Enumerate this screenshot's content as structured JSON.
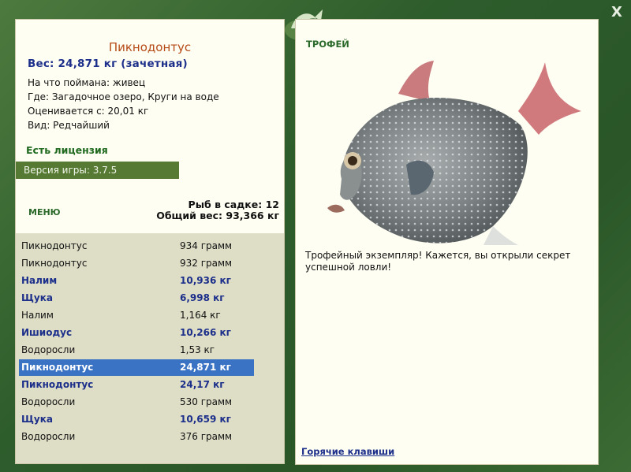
{
  "window": {
    "close_label": "X"
  },
  "fish": {
    "title": "Пикнодонтус",
    "weight": "Вес: 24,871 кг (зачетная)",
    "bait": "На что поймана: живец",
    "location": "Где: Загадочное озеро, Круги на воде",
    "value": "Оценивается с: 20,01 кг",
    "rarity": "Вид: Редчайший"
  },
  "license": "Есть лицензия",
  "version": "Версия игры: 3.7.5",
  "menu_label": "МЕНЮ",
  "stats": {
    "count": "Рыб в садке: 12",
    "total_weight": "Общий вес: 93,366 кг"
  },
  "catch_list": [
    {
      "name": "Пикнодонтус",
      "weight": "934 грамм",
      "style": "normal"
    },
    {
      "name": "Пикнодонтус",
      "weight": "932 грамм",
      "style": "normal"
    },
    {
      "name": "Налим",
      "weight": "10,936 кг",
      "style": "bold"
    },
    {
      "name": "Щука",
      "weight": "6,998 кг",
      "style": "bold"
    },
    {
      "name": "Налим",
      "weight": "1,164 кг",
      "style": "normal"
    },
    {
      "name": "Ишиодус",
      "weight": "10,266 кг",
      "style": "bold"
    },
    {
      "name": "Водоросли",
      "weight": "1,53 кг",
      "style": "normal"
    },
    {
      "name": "Пикнодонтус",
      "weight": "24,871 кг",
      "style": "selected"
    },
    {
      "name": "Пикнодонтус",
      "weight": "24,17 кг",
      "style": "bold"
    },
    {
      "name": "Водоросли",
      "weight": "530 грамм",
      "style": "normal"
    },
    {
      "name": "Щука",
      "weight": "10,659 кг",
      "style": "bold"
    },
    {
      "name": "Водоросли",
      "weight": "376 грамм",
      "style": "normal"
    }
  ],
  "trophy": {
    "label": "ТРОФЕЙ",
    "text": "Трофейный экземпляр! Кажется, вы открыли секрет успешной ловли!"
  },
  "hotkeys_label": "Горячие клавиши",
  "colors": {
    "accent_green": "#567a33",
    "selected_row": "#3a73c4",
    "bold_text": "#1c2f8a",
    "title_text": "#b54a17"
  }
}
